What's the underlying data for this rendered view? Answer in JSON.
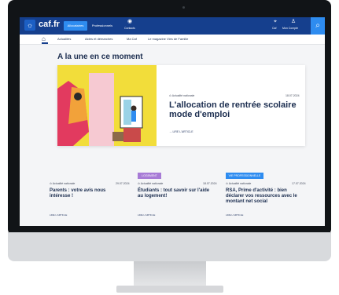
{
  "header": {
    "logo": "caf.fr",
    "tabs": [
      "Allocataires",
      "Professionnels",
      "Contacts"
    ],
    "right_items": [
      "Caf",
      "Mon Compte"
    ]
  },
  "subnav": {
    "items": [
      "Actualités",
      "Aides et démarches",
      "Ma Caf",
      "Le magazine Vies de Famille"
    ]
  },
  "main": {
    "heading": "A la une en ce moment",
    "featured": {
      "category": "Actualité nationale",
      "date": "18.07.2024",
      "title": "L'allocation de rentrée scolaire mode d'emploi",
      "link": "LIRE L'ARTICLE"
    },
    "cards": [
      {
        "tag": "",
        "category": "Actualité nationale",
        "date": "29.07.2024",
        "title": "Parents : votre avis nous intéresse !",
        "link": "LIRE L'ARTICLE"
      },
      {
        "tag": "LOGEMENT",
        "category": "Actualité nationale",
        "date": "18.07.2024",
        "title": "Étudiants : tout savoir sur l'aide au logement!",
        "link": "LIRE L'ARTICLE"
      },
      {
        "tag": "VIE PROFESSIONNELLE",
        "category": "Actualité nationale",
        "date": "17.07.2024",
        "title": "RSA, Prime d'activité : bien déclarer vos ressources avec le montant net social",
        "link": "LIRE L'ARTICLE"
      }
    ]
  },
  "colors": {
    "header": "#153f8d",
    "accent": "#2e8cf0",
    "tag_housing": "#a77bd6",
    "tag_work": "#2e8cf0"
  }
}
